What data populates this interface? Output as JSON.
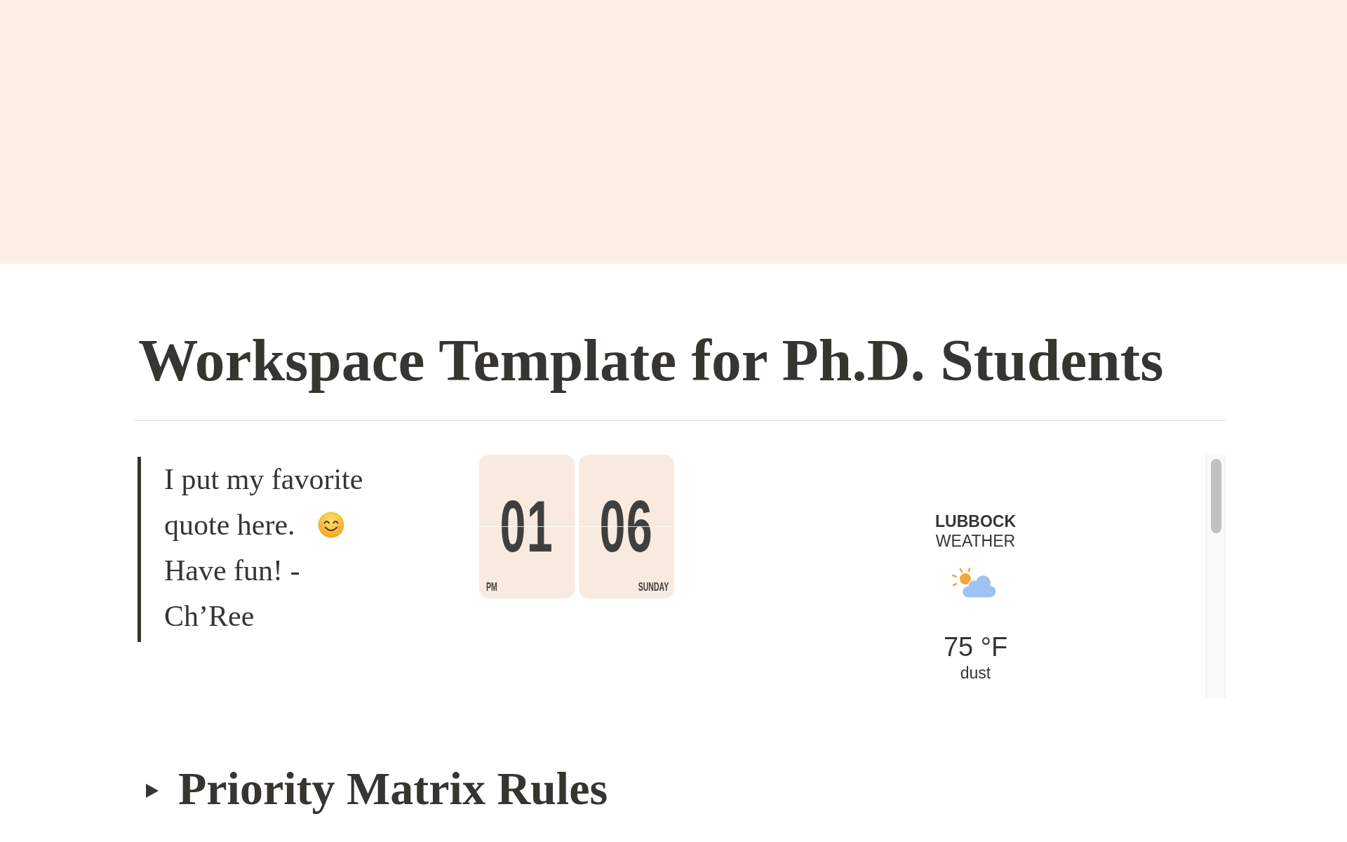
{
  "title": "Workspace Template for Ph.D. Students",
  "quote": {
    "lines": [
      {
        "kind": "plain",
        "text": "I put my favorite"
      },
      {
        "kind": "with_emoji",
        "text": "quote here."
      },
      {
        "kind": "plain",
        "text": "Have fun! -"
      },
      {
        "kind": "plain",
        "text": "Ch’Ree"
      }
    ]
  },
  "clock": {
    "hour": "01",
    "period": "PM",
    "minute": "06",
    "weekday": "SUNDAY"
  },
  "weather": {
    "city": "LUBBOCK",
    "label": "WEATHER",
    "temperature": "75 °F",
    "condition": "dust"
  },
  "sections": [
    {
      "title": "Priority Matrix Rules",
      "expanded": false
    }
  ]
}
